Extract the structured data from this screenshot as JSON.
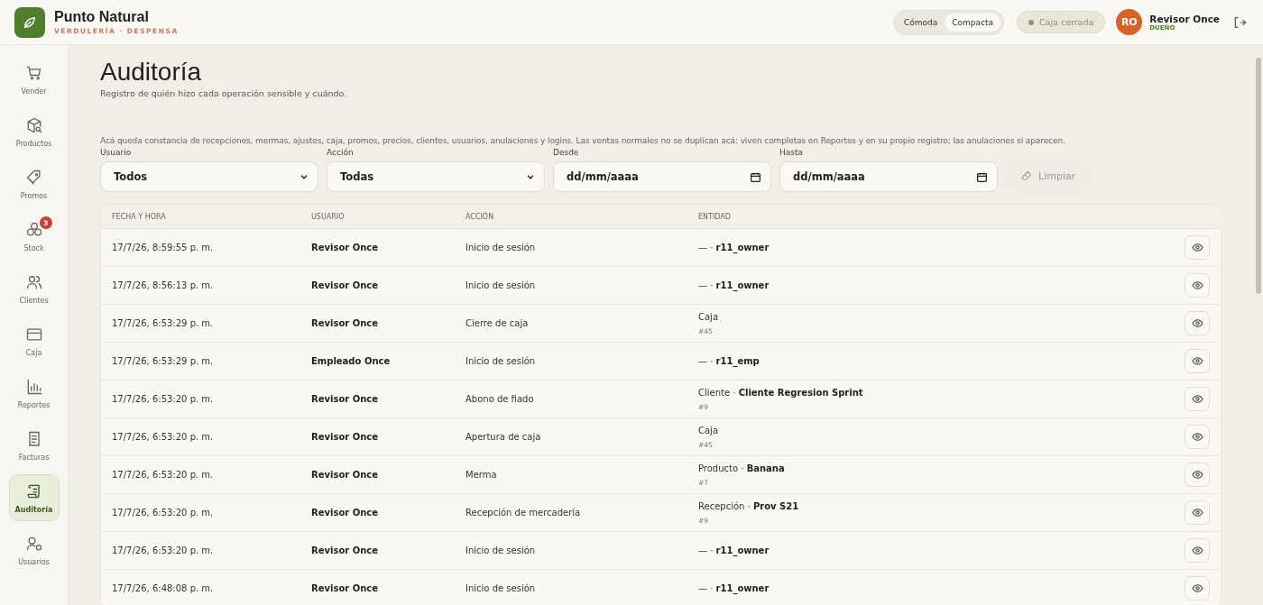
{
  "brand": {
    "name": "Punto Natural",
    "tagline": "VERDULERÍA · DESPENSA"
  },
  "density": [
    {
      "label": "Cómoda",
      "selected": false
    },
    {
      "label": "Compacta",
      "selected": true
    }
  ],
  "cash_status": {
    "label": "Caja cerrada"
  },
  "user": {
    "initials": "RO",
    "name": "Revisor Once",
    "role": "DUEÑO"
  },
  "sidebar": {
    "items": [
      {
        "label": "Vender",
        "selected": false
      },
      {
        "label": "Productos",
        "selected": false
      },
      {
        "label": "Promos",
        "selected": false
      },
      {
        "label": "Stock",
        "selected": false,
        "badge": "3"
      },
      {
        "label": "Clientes",
        "selected": false
      },
      {
        "label": "Caja",
        "selected": false
      },
      {
        "label": "Reportes",
        "selected": false
      },
      {
        "label": "Facturas",
        "selected": false
      },
      {
        "label": "Auditoría",
        "selected": true
      },
      {
        "label": "Usuarios",
        "selected": false
      }
    ]
  },
  "page": {
    "title": "Auditoría",
    "subtitle": "Registro de quién hizo cada operación sensible y cuándo.",
    "note": "Acá queda constancia de recepciones, mermas, ajustes, caja, promos, precios, clientes, usuarios, anulaciones y logins. Las ventas normales no se duplican acá: viven completas en Reportes y en su propio registro; las anulaciones sí aparecen."
  },
  "filters": [
    {
      "kind": "select",
      "label": "Usuario",
      "value": "Todos"
    },
    {
      "kind": "select",
      "label": "Acción",
      "value": "Todas"
    },
    {
      "kind": "date",
      "label": "Desde",
      "value": "dd/mm/aaaa"
    },
    {
      "kind": "date",
      "label": "Hasta",
      "value": "dd/mm/aaaa"
    }
  ],
  "clear_button": {
    "label": "Limpiar",
    "disabled": true
  },
  "table": {
    "columns": [
      "FECHA Y HORA",
      "USUARIO",
      "ACCIÓN",
      "ENTIDAD"
    ],
    "rows": [
      {
        "date": "17/7/26, 8:59:55 p. m.",
        "user": "Revisor Once",
        "action": "Inicio de sesión",
        "entity": "— · **r11_owner**"
      },
      {
        "date": "17/7/26, 8:56:13 p. m.",
        "user": "Revisor Once",
        "action": "Inicio de sesión",
        "entity": "— · **r11_owner**"
      },
      {
        "date": "17/7/26, 6:53:29 p. m.",
        "user": "Revisor Once",
        "action": "Cierre de caja",
        "entity": "Caja",
        "ref": "#45"
      },
      {
        "date": "17/7/26, 6:53:29 p. m.",
        "user": "Empleado Once",
        "action": "Inicio de sesión",
        "entity": "— · **r11_emp**"
      },
      {
        "date": "17/7/26, 6:53:20 p. m.",
        "user": "Revisor Once",
        "action": "Abono de fiado",
        "entity": "Cliente · **Cliente Regresion Sprint**",
        "ref": "#9"
      },
      {
        "date": "17/7/26, 6:53:20 p. m.",
        "user": "Revisor Once",
        "action": "Apertura de caja",
        "entity": "Caja",
        "ref": "#45"
      },
      {
        "date": "17/7/26, 6:53:20 p. m.",
        "user": "Revisor Once",
        "action": "Merma",
        "entity": "Producto · **Banana**",
        "ref": "#7"
      },
      {
        "date": "17/7/26, 6:53:20 p. m.",
        "user": "Revisor Once",
        "action": "Recepción de mercadería",
        "entity": "Recepción · **Prov S21**",
        "ref": "#9"
      },
      {
        "date": "17/7/26, 6:53:20 p. m.",
        "user": "Revisor Once",
        "action": "Inicio de sesión",
        "entity": "— · **r11_owner**"
      },
      {
        "date": "17/7/26, 6:48:08 p. m.",
        "user": "Revisor Once",
        "action": "Inicio de sesión",
        "entity": "— · **r11_owner**"
      }
    ]
  }
}
